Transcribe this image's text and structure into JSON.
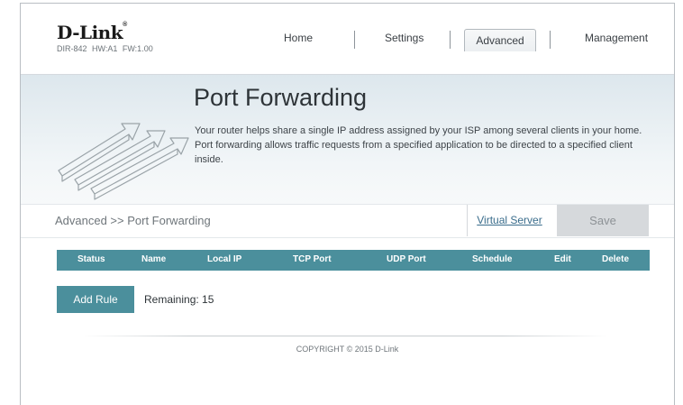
{
  "brand": {
    "logo": "D-Link",
    "hw_info": "DIR-842  HW:A1  FW:1.00"
  },
  "nav": {
    "home": "Home",
    "settings": "Settings",
    "advanced": "Advanced",
    "management": "Management",
    "active": "Advanced"
  },
  "banner": {
    "title": "Port Forwarding",
    "description": "Your router helps share a single IP address assigned by your ISP among several clients in your home. Port forwarding allows traffic requests from a specified application to be directed to a specified client inside."
  },
  "breadcrumb": "Advanced >> Port Forwarding",
  "virtual_server_link": "Virtual Server",
  "save_label": "Save",
  "table": {
    "columns": [
      "Status",
      "Name",
      "Local IP",
      "TCP Port",
      "UDP Port",
      "Schedule",
      "Edit",
      "Delete"
    ],
    "rows": []
  },
  "add_rule_label": "Add Rule",
  "remaining": "Remaining: 15",
  "footer": "COPYRIGHT © 2015 D-Link",
  "colors": {
    "accent": "#4b8f9c",
    "save_disabled": "#d6d9dc",
    "link": "#3a6d8c"
  },
  "icons": {
    "illustration": "port-forward-arrows-icon"
  }
}
